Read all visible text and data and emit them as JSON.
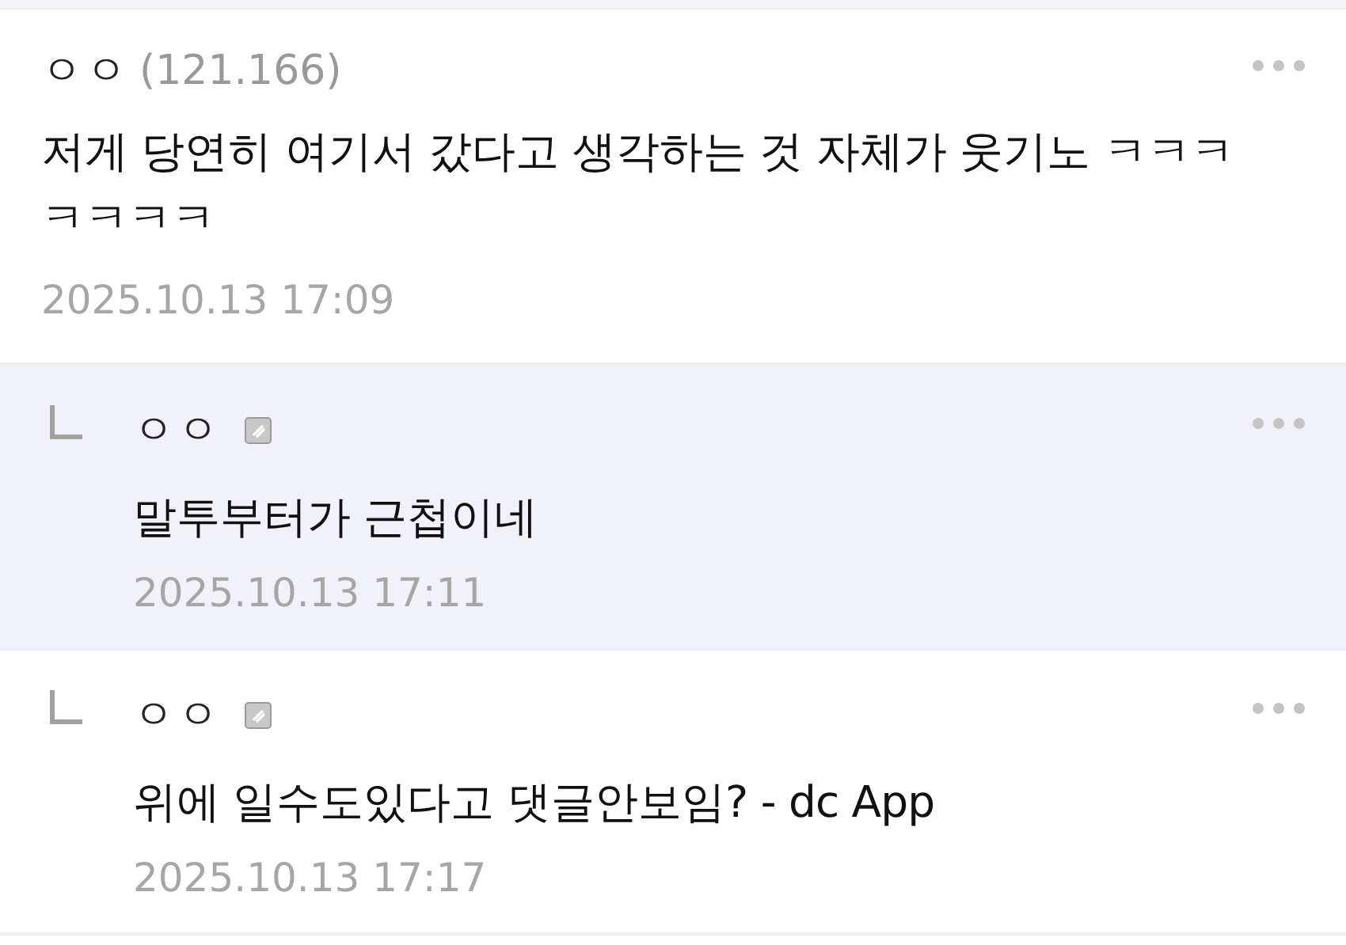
{
  "comments": [
    {
      "kind": "comment",
      "highlighted": false,
      "nickname": "ㅇㅇ",
      "ip": "(121.166)",
      "badge": false,
      "text": "저게 당연히 여기서 갔다고 생각하는 것 자체가 웃기노 ㅋㅋㅋㅋㅋㅋㅋ",
      "date": "2025.10.13 17:09"
    },
    {
      "kind": "reply",
      "highlighted": true,
      "nickname": "ㅇㅇ",
      "badge": true,
      "text": "말투부터가 근첩이네",
      "date": "2025.10.13 17:11"
    },
    {
      "kind": "reply",
      "highlighted": false,
      "nickname": "ㅇㅇ",
      "badge": true,
      "text": "위에 일수도있다고 댓글안보임? - dc App",
      "date": "2025.10.13 17:17"
    }
  ]
}
